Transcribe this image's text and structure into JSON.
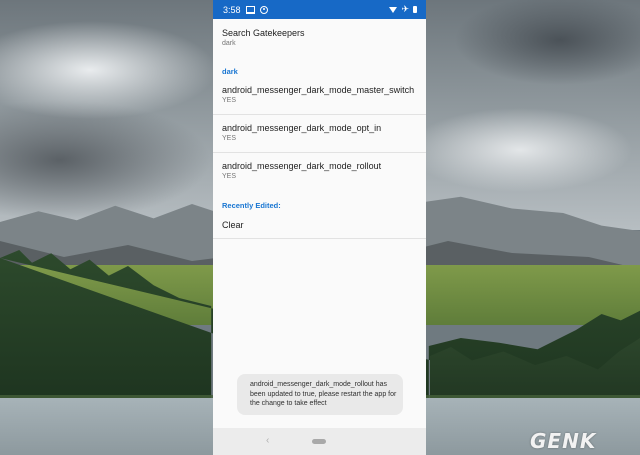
{
  "status_bar": {
    "time": "3:58",
    "bg_color": "#1769c6",
    "icons_left": [
      "monitor-icon",
      "circle-notification-icon"
    ],
    "icons_right": [
      "wifi-icon",
      "airplane-icon",
      "battery-icon"
    ]
  },
  "search": {
    "title": "Search Gatekeepers",
    "value": "dark"
  },
  "section_dark": {
    "header": "dark",
    "items": [
      {
        "name": "android_messenger_dark_mode_master_switch",
        "value": "YES"
      },
      {
        "name": "android_messenger_dark_mode_opt_in",
        "value": "YES"
      },
      {
        "name": "android_messenger_dark_mode_rollout",
        "value": "YES"
      }
    ]
  },
  "section_recent": {
    "header": "Recently Edited:",
    "clear_label": "Clear"
  },
  "snackbar": {
    "message": "android_messenger_dark_mode_rollout has been updated to true, please restart the app for the change to take effect"
  },
  "nav_bar": {
    "back_glyph": "‹"
  },
  "watermark": {
    "text": "GENK"
  },
  "colors": {
    "accent": "#1976d2",
    "surface": "#fafafa"
  }
}
